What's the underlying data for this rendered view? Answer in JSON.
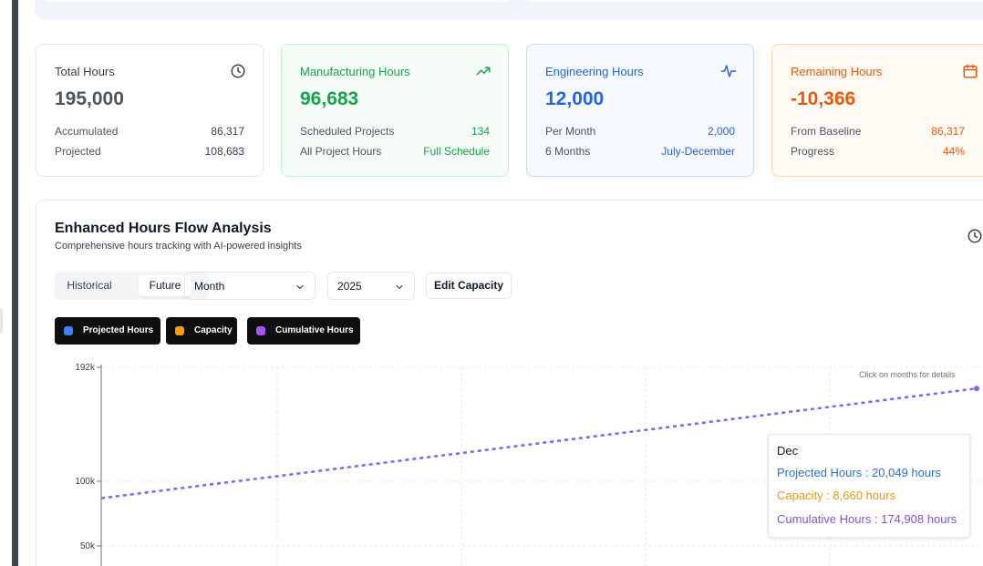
{
  "cards": [
    {
      "title": "Total Hours",
      "icon": "clock-icon",
      "value": "195,000",
      "rows": [
        {
          "label": "Accumulated",
          "value": "86,317"
        },
        {
          "label": "Projected",
          "value": "108,683"
        }
      ]
    },
    {
      "title": "Manufacturing Hours",
      "icon": "trending-up-icon",
      "value": "96,683",
      "rows": [
        {
          "label": "Scheduled Projects",
          "value": "134"
        },
        {
          "label": "All Project Hours",
          "value": "Full Schedule"
        }
      ]
    },
    {
      "title": "Engineering Hours",
      "icon": "activity-icon",
      "value": "12,000",
      "rows": [
        {
          "label": "Per Month",
          "value": "2,000"
        },
        {
          "label": "6 Months",
          "value": "July-December"
        }
      ]
    },
    {
      "title": "Remaining Hours",
      "icon": "calendar-icon",
      "value": "-10,366",
      "rows": [
        {
          "label": "From Baseline",
          "value": "86,317"
        },
        {
          "label": "Progress",
          "value": "44%"
        }
      ]
    }
  ],
  "panel": {
    "title": "Enhanced Hours Flow Analysis",
    "subtitle": "Comprehensive hours tracking with AI-powered insights",
    "toggle": {
      "historical": "Historical",
      "future": "Future",
      "selected": "Future"
    },
    "period_select": {
      "value": "Month"
    },
    "year_select": {
      "value": "2025"
    },
    "edit_button": "Edit Capacity",
    "legend": [
      {
        "label": "Projected Hours",
        "color": "#3b82f6"
      },
      {
        "label": "Capacity",
        "color": "#f59e0b"
      },
      {
        "label": "Cumulative Hours",
        "color": "#a855f7"
      }
    ],
    "hint": "Click on months for details"
  },
  "tooltip": {
    "month": "Dec",
    "projected": "Projected Hours : 20,049 hours",
    "capacity": "Capacity : 8,660 hours",
    "cumulative": "Cumulative Hours : 174,908 hours"
  },
  "chart_data": {
    "type": "line",
    "y_ticks": [
      "192k",
      "100k",
      "50k"
    ],
    "series": [
      {
        "name": "Cumulative Hours",
        "color": "#8b5cf6",
        "x": [
          "start",
          "Dec"
        ],
        "values": [
          86317,
          174908
        ]
      }
    ],
    "grid": true
  }
}
